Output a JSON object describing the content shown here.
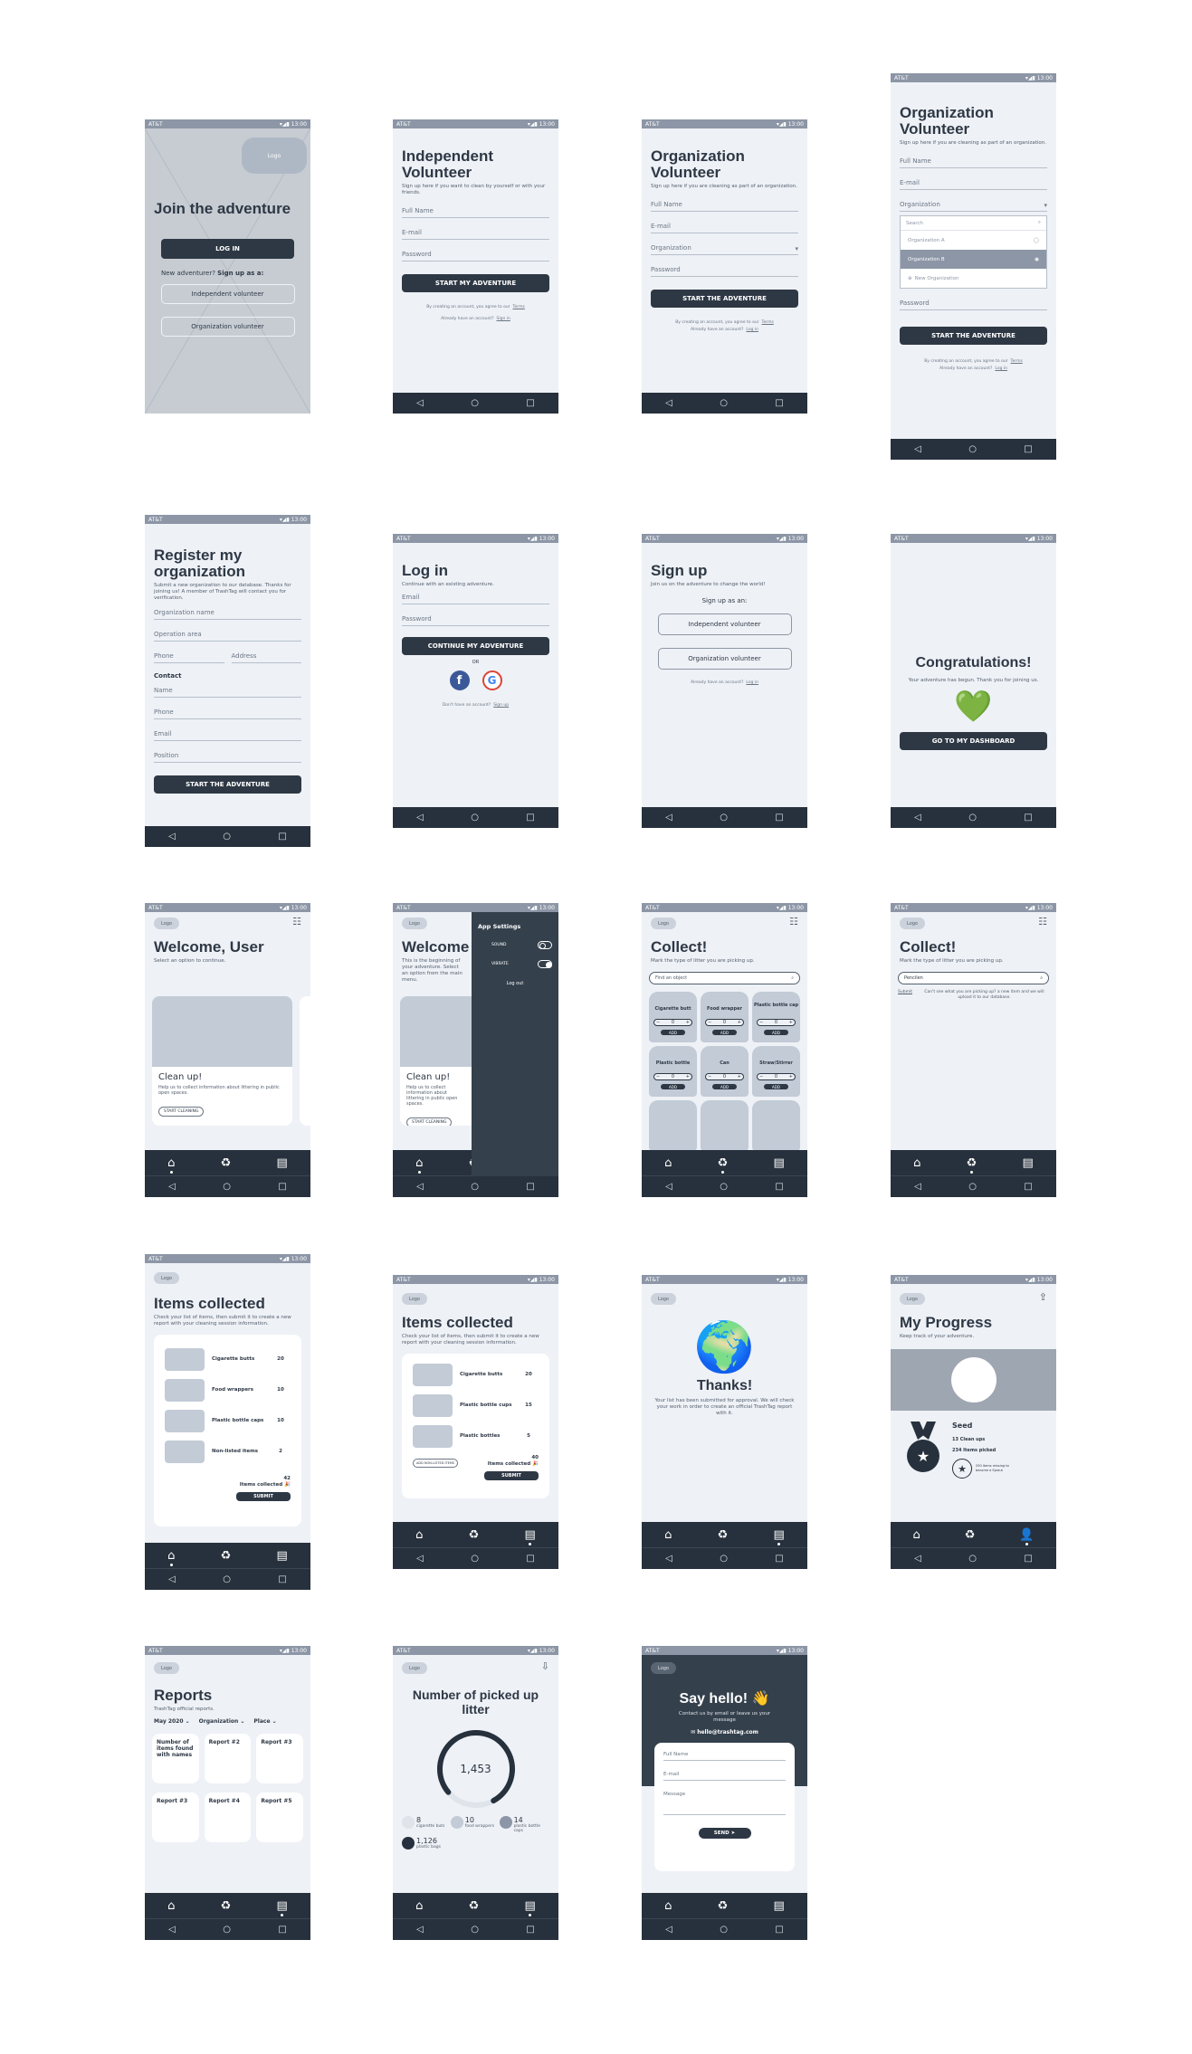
{
  "status": {
    "carrier": "AT&T",
    "icons": "▾◢▮",
    "time": "13:00"
  },
  "nav": {
    "back": "◁",
    "home": "○",
    "recent": "□"
  },
  "tabs": {
    "home": "⌂",
    "recycle": "♻",
    "report": "▤",
    "profile": "👤"
  },
  "logo": "Logo",
  "s1": {
    "title": "Join the adventure",
    "login": "LOG IN",
    "prompt": "New adventurer?",
    "prompt_bold": "Sign up as a:",
    "opt1": "Independent volunteer",
    "opt2": "Organization volunteer"
  },
  "s2": {
    "title": "Independent Volunteer",
    "subtitle": "Sign up here if you want to clean by yourself or with your friends.",
    "f1": "Full Name",
    "f2": "E-mail",
    "f3": "Password",
    "btn": "START MY ADVENTURE",
    "terms": "By creating an account, you agree to our",
    "terms_link": "Terms",
    "already": "Already have an account?",
    "signin": "Sign in"
  },
  "s3": {
    "title": "Organization Volunteer",
    "subtitle": "Sign up here if you are cleaning as part of an organization.",
    "f1": "Full Name",
    "f2": "E-mail",
    "f3": "Organization",
    "f4": "Password",
    "btn": "START THE ADVENTURE",
    "terms": "By creating an account, you agree to our",
    "terms_link": "Terms",
    "already": "Already have an account?",
    "login": "Log in"
  },
  "s4": {
    "title": "Organization Volunteer",
    "subtitle": "Sign up here if you are cleaning as part of an organization.",
    "f1": "Full Name",
    "f2": "E-mail",
    "f3": "Organization",
    "search": "Search",
    "optA": "Organization A",
    "optB": "Organization B",
    "optNew": "New Organization",
    "f4": "Password",
    "btn": "START THE ADVENTURE",
    "terms": "By creating an account, you agree to our",
    "terms_link": "Terms",
    "already": "Already have an account?",
    "login": "Log in"
  },
  "s5": {
    "title": "Register my organization",
    "subtitle": "Submit a new organization to our database. Thanks for joining us! A member of TrashTag will contact you for verification.",
    "f1": "Organization name",
    "f2": "Operation area",
    "f3": "Phone",
    "f4": "Address",
    "contact": "Contact",
    "f5": "Name",
    "f6": "Phone",
    "f7": "Email",
    "f8": "Position",
    "btn": "START THE ADVENTURE"
  },
  "s6": {
    "title": "Log in",
    "subtitle": "Continue with an existing adventure.",
    "f1": "Email",
    "f2": "Password",
    "btn": "CONTINUE MY ADVENTURE",
    "or": "OR",
    "fb": "f",
    "g": "G",
    "noacc": "Don't have an account?",
    "signup": "Sign up"
  },
  "s7": {
    "title": "Sign up",
    "subtitle": "Join us on the adventure to change the world!",
    "label": "Sign up as an:",
    "opt1": "Independent volunteer",
    "opt2": "Organization volunteer",
    "already": "Already have an account?",
    "login": "Log in"
  },
  "s8": {
    "title": "Congratulations!",
    "subtitle": "Your adventure has begun. Thank you for joining us.",
    "heart": "💚",
    "btn": "GO TO MY DASHBOARD"
  },
  "s9": {
    "title": "Welcome, User",
    "subtitle": "Select an option to continue.",
    "card": "Clean up!",
    "card_desc": "Help us to collect information about littering in public open spaces.",
    "card_btn": "START CLEANING"
  },
  "s10": {
    "title": "Welcome",
    "subtitle": "This is the beginning of your adventure. Select an option from the main menu.",
    "card": "Clean up!",
    "card_desc": "Help us to collect information about littering in public open spaces.",
    "card_btn": "START CLEANING",
    "panel_title": "App Settings",
    "sound": "SOUND",
    "vibrate": "VIBRATE",
    "logout": "Log out"
  },
  "s11": {
    "title": "Collect!",
    "subtitle": "Mark the type of litter you are picking up.",
    "search": "Find an object",
    "items": [
      "Cigarette butt",
      "Food wrapper",
      "Plastic bottle cap",
      "Plastic bottle",
      "Can",
      "Straw/Stirrer"
    ],
    "qty": "0",
    "minus": "−",
    "plus": "+",
    "add": "ADD"
  },
  "s12": {
    "title": "Collect!",
    "subtitle": "Mark the type of litter you are picking up.",
    "search": "Pencilen",
    "submit": "Submit",
    "msg": "Can't see what you are picking up? a new item and we will upload it to our database."
  },
  "s13": {
    "title": "Items collected",
    "subtitle": "Check your list of items, then submit it to create a new report with your cleaning session information.",
    "items": [
      {
        "name": "Cigarette butts",
        "qty": "20"
      },
      {
        "name": "Food wrappers",
        "qty": "10"
      },
      {
        "name": "Plastic bottle caps",
        "qty": "10"
      },
      {
        "name": "Non-listed items",
        "qty": "2"
      }
    ],
    "total": "42",
    "total_label": "Items collected",
    "party": "🎉",
    "btn": "SUBMIT"
  },
  "s14": {
    "title": "Items collected",
    "subtitle": "Check your list of items, then submit it to create a new report with your cleaning session information.",
    "items": [
      {
        "name": "Cigarette butts",
        "qty": "20"
      },
      {
        "name": "Plastic bottle cups",
        "qty": "15"
      },
      {
        "name": "Plastic bottles",
        "qty": "5"
      }
    ],
    "addnew": "ADD NON-LISTED ITEMS",
    "total": "40",
    "total_label": "Items collected",
    "party": "🎉",
    "btn": "SUBMIT"
  },
  "s15": {
    "globe": "🌍",
    "title": "Thanks!",
    "desc": "Your list has been submitted for approval. We will check your work in order to create an official TrashTag report with it."
  },
  "s16": {
    "title": "My Progress",
    "subtitle": "Keep track of your adventure.",
    "share": "⇪",
    "level": "Seed",
    "cleanups": "13 Clean ups",
    "picked": "234 Items picked",
    "next": "250 Items missing to become a Sprout",
    "medal": "🏅",
    "star": "★"
  },
  "s17": {
    "title": "Reports",
    "subtitle": "TrashTag official reports.",
    "f1": "May 2020",
    "f2": "Organization",
    "f3": "Place",
    "reports": [
      "Number of items found with names",
      "Report #2",
      "Report #3",
      "Report #3",
      "Report #4",
      "Report #5"
    ]
  },
  "s18": {
    "title": "Number of picked up litter",
    "download": "⇩",
    "total": "1,453",
    "progress": 0.78,
    "stats": [
      {
        "value": "8",
        "label": "cigarette buts"
      },
      {
        "value": "10",
        "label": "food wrappers"
      },
      {
        "value": "14",
        "label": "plastic bottle caps"
      },
      {
        "value": "1,126",
        "label": "plastic bags"
      }
    ],
    "colors": [
      "#dfe4ea",
      "#c2cbd6",
      "#8c96a6",
      "#27313d"
    ]
  },
  "s19": {
    "title": "Say hello! 👋",
    "subtitle": "Contact us by email or leave us your message",
    "email": "✉ hello@trashtag.com",
    "f1": "Full Name",
    "f2": "E-mail",
    "f3": "Message",
    "btn": "SEND ➤"
  }
}
